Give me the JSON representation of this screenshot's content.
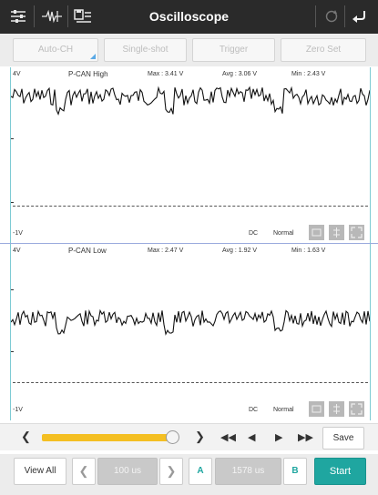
{
  "app": {
    "title": "Oscilloscope",
    "toolbar_icons": [
      "sliders-icon",
      "trigger-wave-icon",
      "save-list-icon"
    ],
    "right_icons": [
      "refresh-icon",
      "back-icon"
    ]
  },
  "modes": {
    "auto_ch": "Auto-CH",
    "single_shot": "Single-shot",
    "trigger": "Trigger",
    "zero_set": "Zero Set"
  },
  "channels": [
    {
      "name": "P-CAN High",
      "scale_top": "4V",
      "scale_bottom": "-1V",
      "max": "Max : 3.41 V",
      "avg": "Avg : 3.06 V",
      "min": "Min : 2.43 V",
      "coupling": "DC",
      "mode": "Normal"
    },
    {
      "name": "P-CAN Low",
      "scale_top": "4V",
      "scale_bottom": "-1V",
      "max": "Max : 2.47 V",
      "avg": "Avg : 1.92 V",
      "min": "Min : 1.63 V",
      "coupling": "DC",
      "mode": "Normal"
    }
  ],
  "playback": {
    "position": 0.96,
    "save_label": "Save"
  },
  "controls": {
    "view_all": "View All",
    "time_div": "100 us",
    "cursor_a": "A",
    "cursor_delta": "1578 us",
    "cursor_b": "B",
    "start": "Start"
  },
  "colors": {
    "accent": "#1fa6a0",
    "slider": "#f4bf22",
    "titlebar": "#2a2a2a",
    "trace": "#111111"
  }
}
